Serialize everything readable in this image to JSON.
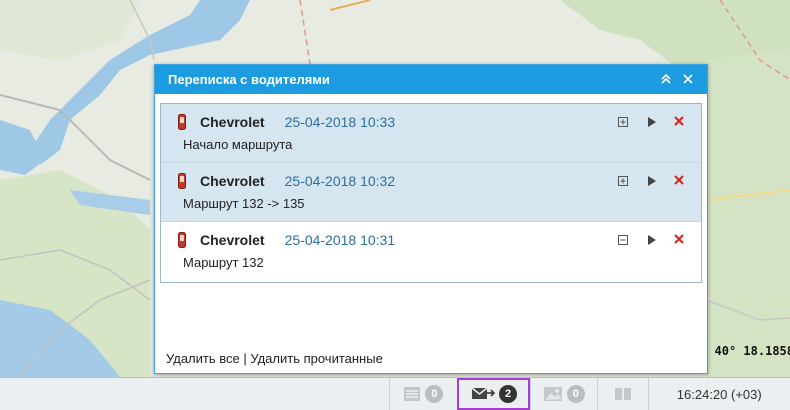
{
  "map": {
    "coordinate": "40° 18.1858"
  },
  "dialog": {
    "title": "Переписка с водителями",
    "collapse_icon": "double-chevron-up-icon",
    "close_icon": "close-icon",
    "messages": [
      {
        "name": "Chevrolet",
        "time": "25-04-2018 10:33",
        "text": "Начало маршрута",
        "unread": true,
        "expand_icon": "plus-box-icon"
      },
      {
        "name": "Chevrolet",
        "time": "25-04-2018 10:32",
        "text": "Маршрут 132 -> 135",
        "unread": true,
        "expand_icon": "plus-box-icon"
      },
      {
        "name": "Chevrolet",
        "time": "25-04-2018 10:31",
        "text": "Маршрут 132",
        "unread": false,
        "expand_icon": "minus-box-icon"
      }
    ],
    "footer": {
      "delete_all": "Удалить все",
      "separator": " | ",
      "delete_read": "Удалить прочитанные"
    }
  },
  "statusbar": {
    "tasks_count": "0",
    "messages_count": "2",
    "photos_count": "0",
    "clock": "16:24:20 (+03)"
  },
  "colors": {
    "accent": "#1c9be0",
    "delete": "#d9221b",
    "time": "#2d6ea3",
    "highlight": "#a43ed6"
  }
}
